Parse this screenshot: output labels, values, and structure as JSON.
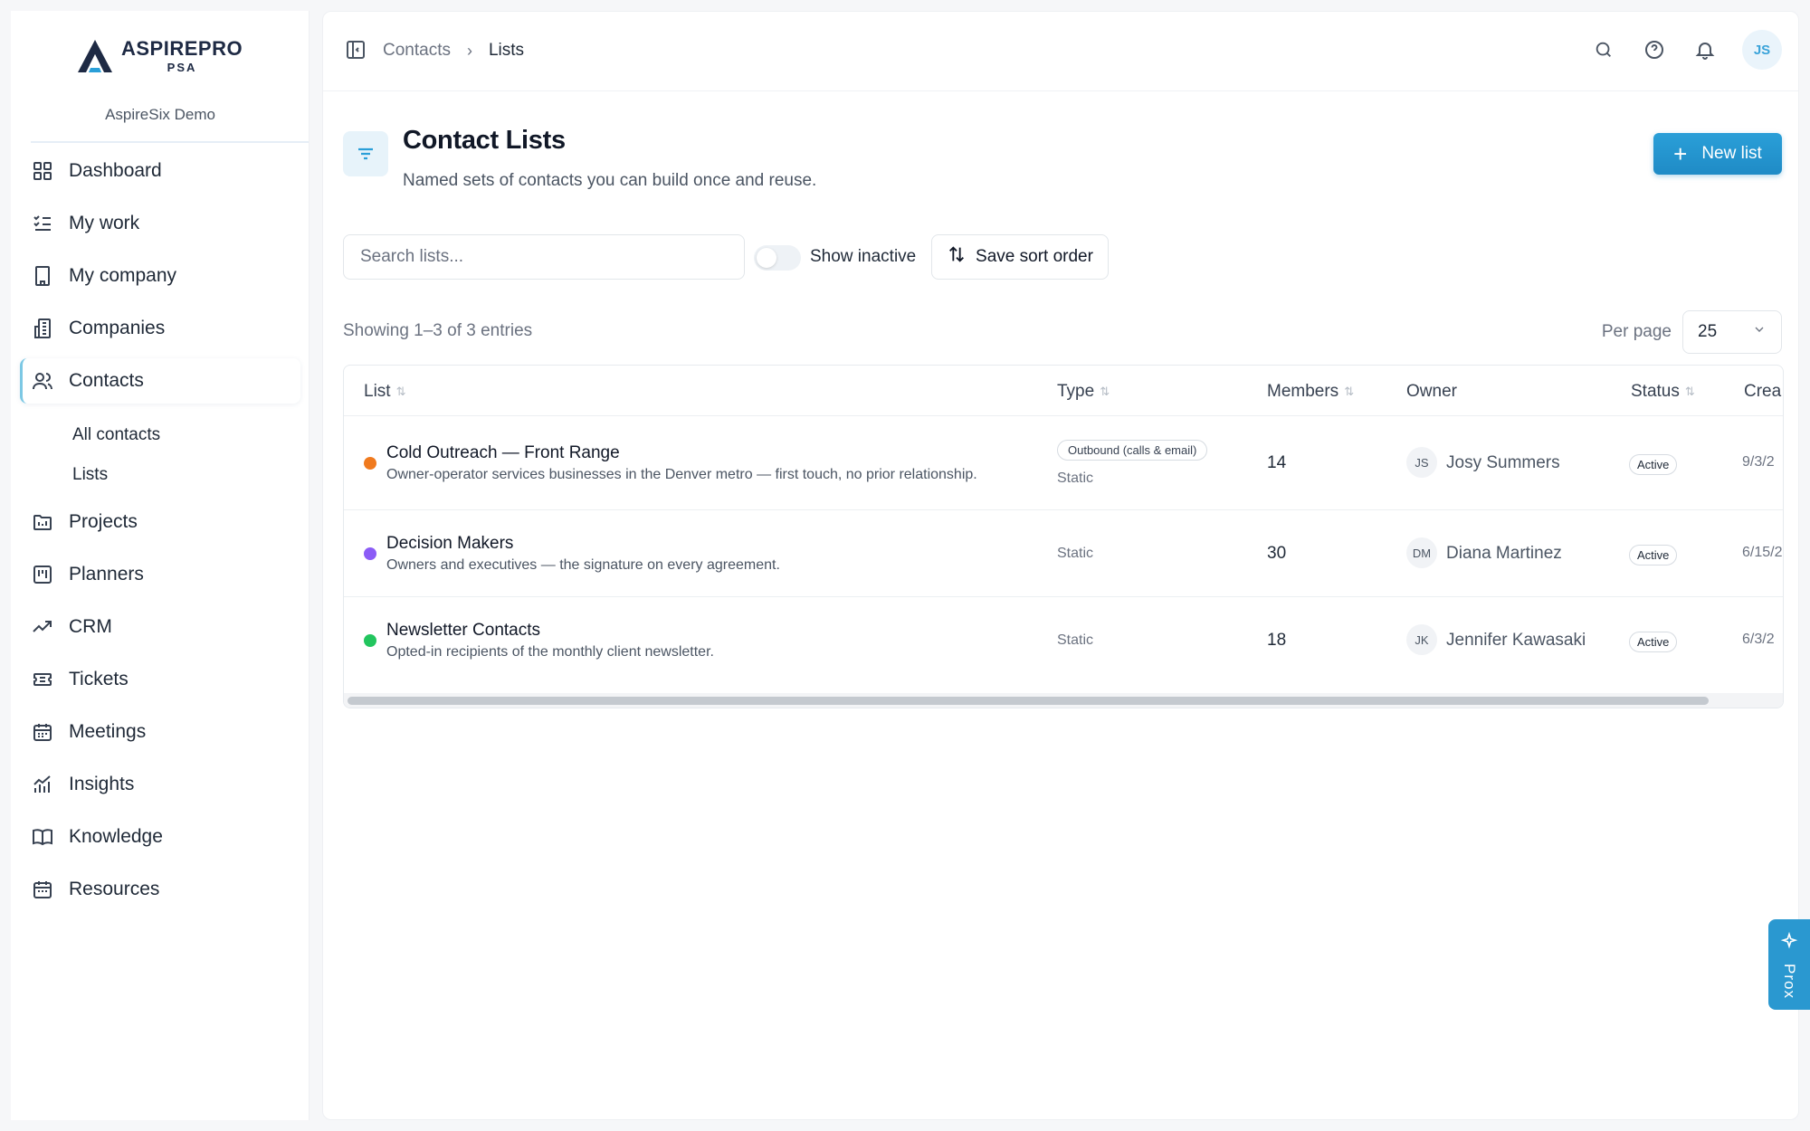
{
  "brand": {
    "name": "ASPIREPRO",
    "sub": "PSA",
    "org": "AspireSix Demo"
  },
  "nav": {
    "items": [
      {
        "label": "Dashboard",
        "icon": "dashboard-icon"
      },
      {
        "label": "My work",
        "icon": "checklist-icon"
      },
      {
        "label": "My company",
        "icon": "building-icon"
      },
      {
        "label": "Companies",
        "icon": "companies-icon"
      },
      {
        "label": "Contacts",
        "icon": "users-icon",
        "active": true
      },
      {
        "label": "Projects",
        "icon": "folder-icon"
      },
      {
        "label": "Planners",
        "icon": "planner-icon"
      },
      {
        "label": "CRM",
        "icon": "trending-up-icon"
      },
      {
        "label": "Tickets",
        "icon": "ticket-icon"
      },
      {
        "label": "Meetings",
        "icon": "calendar-icon"
      },
      {
        "label": "Insights",
        "icon": "chart-icon"
      },
      {
        "label": "Knowledge",
        "icon": "book-icon"
      },
      {
        "label": "Resources",
        "icon": "calendar-icon"
      }
    ],
    "contacts_sub": [
      "All contacts",
      "Lists"
    ]
  },
  "breadcrumb": {
    "parent": "Contacts",
    "separator": "›",
    "current": "Lists"
  },
  "user": {
    "initials": "JS"
  },
  "page": {
    "title": "Contact Lists",
    "subtitle": "Named sets of contacts you can build once and reuse.",
    "new_button": "New list"
  },
  "filters": {
    "search_placeholder": "Search lists...",
    "show_inactive": "Show inactive",
    "show_inactive_on": false,
    "save_sort": "Save sort order"
  },
  "pagination": {
    "showing": "Showing 1–3 of 3 entries",
    "per_page_label": "Per page",
    "per_page": "25"
  },
  "table": {
    "columns": [
      "List",
      "Type",
      "Members",
      "Owner",
      "Status",
      "Crea"
    ],
    "rows": [
      {
        "dot_color": "#f07a1e",
        "name": "Cold Outreach — Front Range",
        "description": "Owner-operator services businesses in the Denver metro — first touch, no prior relationship.",
        "type_badge": "Outbound (calls & email)",
        "type": "Static",
        "members": "14",
        "owner_initials": "JS",
        "owner": "Josy Summers",
        "status": "Active",
        "created": "9/3/2"
      },
      {
        "dot_color": "#8b5cf6",
        "name": "Decision Makers",
        "description": "Owners and executives — the signature on every agreement.",
        "type_badge": "",
        "type": "Static",
        "members": "30",
        "owner_initials": "DM",
        "owner": "Diana Martinez",
        "status": "Active",
        "created": "6/15/2"
      },
      {
        "dot_color": "#22c55e",
        "name": "Newsletter Contacts",
        "description": "Opted-in recipients of the monthly client newsletter.",
        "type_badge": "",
        "type": "Static",
        "members": "18",
        "owner_initials": "JK",
        "owner": "Jennifer Kawasaki",
        "status": "Active",
        "created": "6/3/2"
      }
    ]
  },
  "assistant": {
    "label": "Prox"
  },
  "colors": {
    "accent": "#2a9fd8",
    "active_border": "#7cc8e4"
  }
}
